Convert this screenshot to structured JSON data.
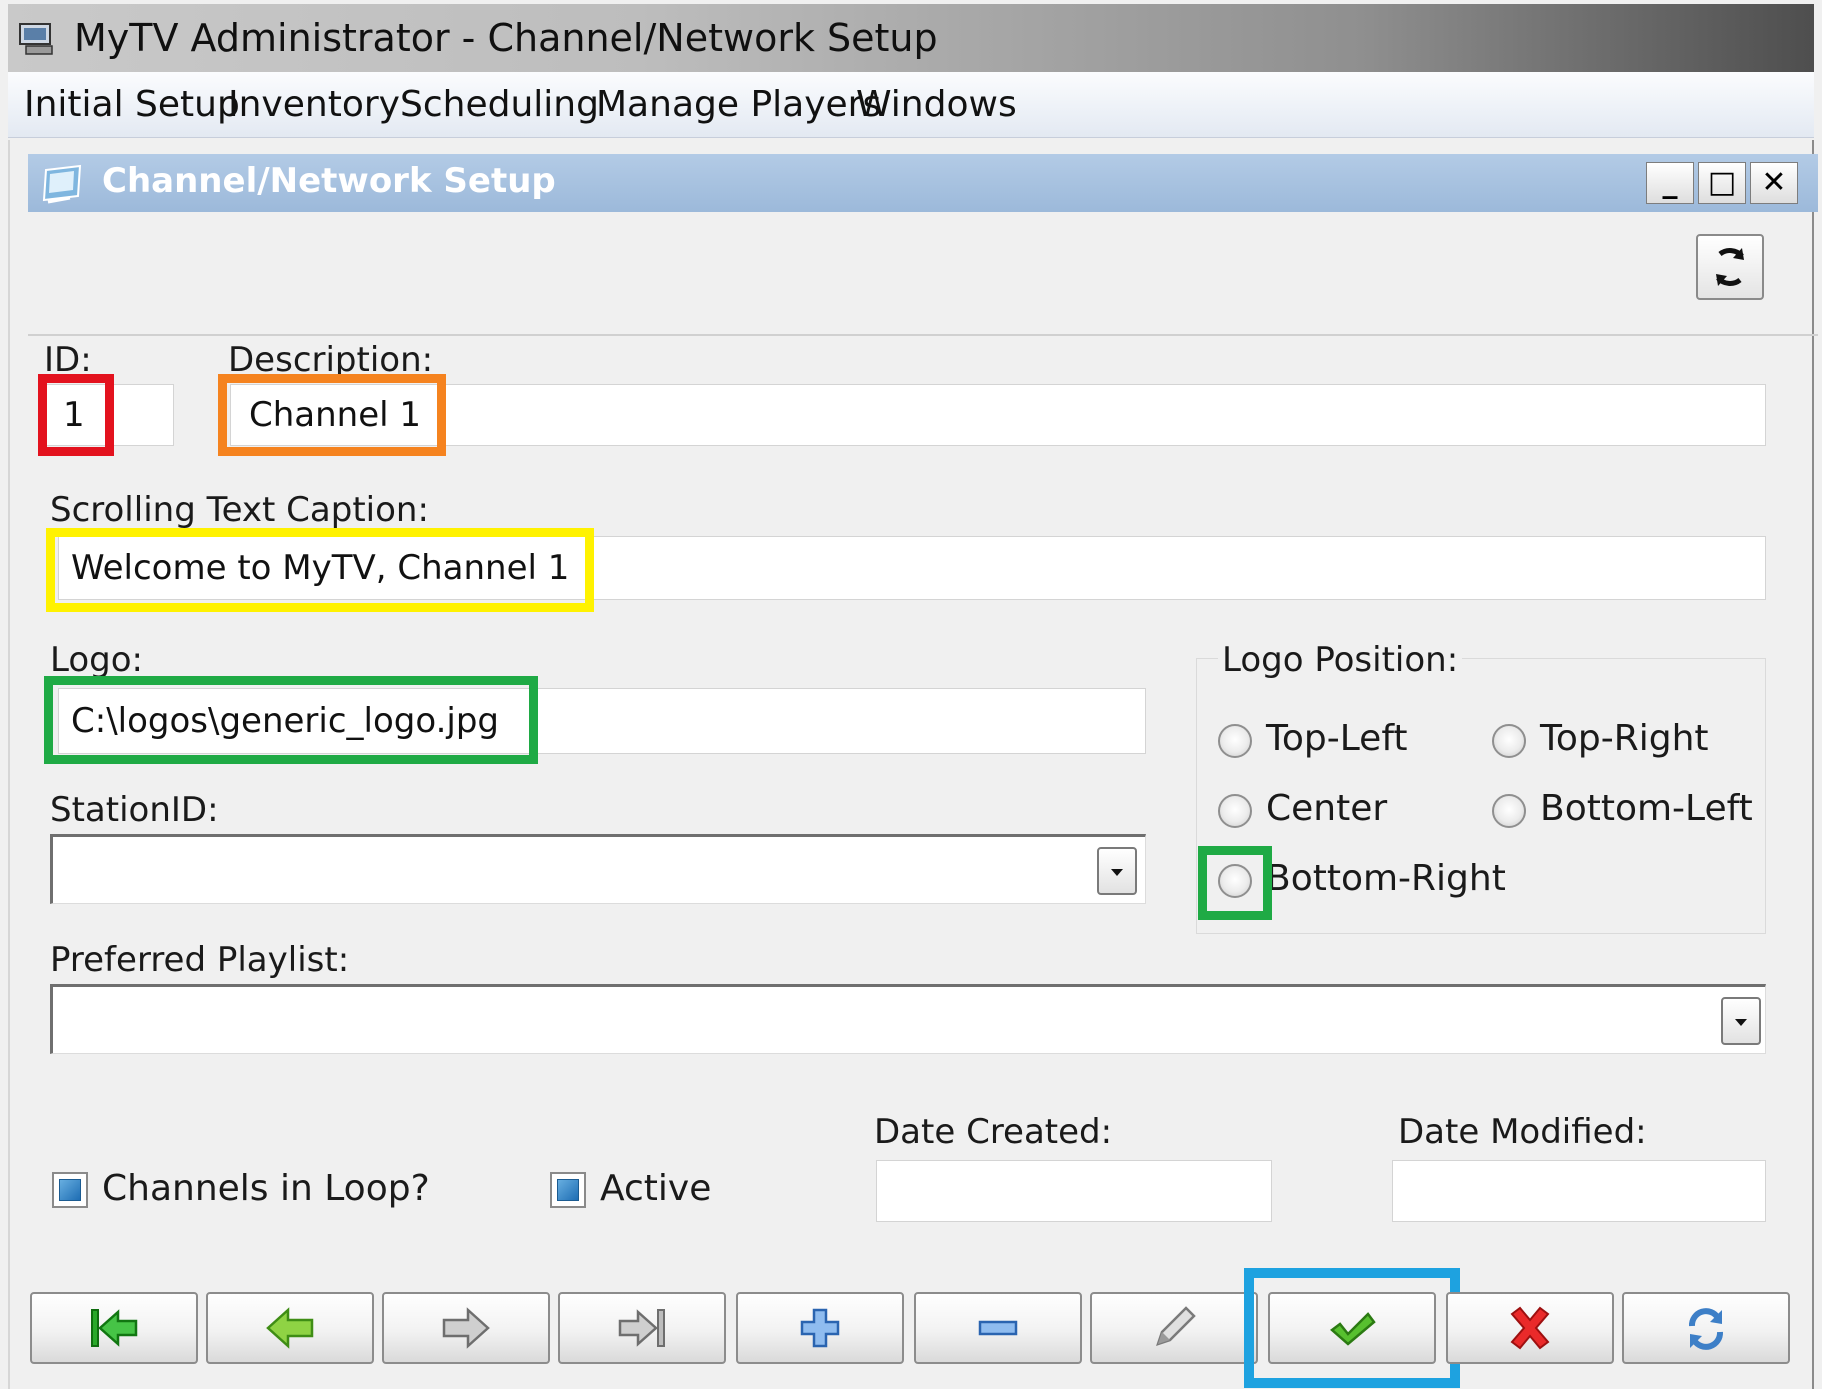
{
  "app": {
    "title": "MyTV Administrator - Channel/Network Setup"
  },
  "menu": {
    "items": [
      "Initial Setup",
      "Inventory",
      "Scheduling",
      "Manage Players",
      "Windows"
    ]
  },
  "window": {
    "title": "Channel/Network Setup",
    "minimize": "_",
    "maximize": "□",
    "close": "✕"
  },
  "form": {
    "id_label": "ID:",
    "id_value": "1",
    "description_label": "Description:",
    "description_value": "Channel 1",
    "caption_label": "Scrolling Text Caption:",
    "caption_value": "Welcome to MyTV, Channel 1",
    "logo_label": "Logo:",
    "logo_value": "C:\\logos\\generic_logo.jpg",
    "station_label": "StationID:",
    "station_value": "",
    "playlist_label": "Preferred Playlist:",
    "playlist_value": "",
    "logo_position": {
      "label": "Logo Position:",
      "options": [
        "Top-Left",
        "Top-Right",
        "Center",
        "Bottom-Left",
        "Bottom-Right"
      ],
      "selected": ""
    },
    "loop_label": "Channels in Loop?",
    "active_label": "Active",
    "date_created_label": "Date Created:",
    "date_created_value": "",
    "date_modified_label": "Date Modified:",
    "date_modified_value": ""
  },
  "highlight_colors": {
    "id": "#e3121e",
    "description": "#f5831f",
    "caption": "#fff200",
    "logo": "#1faa45",
    "save": "#1ea2e0"
  },
  "nav_buttons": [
    "first-record",
    "previous-record",
    "next-record",
    "last-record",
    "add-record",
    "delete-record",
    "edit-record",
    "save-record",
    "cancel-record",
    "refresh-records"
  ]
}
